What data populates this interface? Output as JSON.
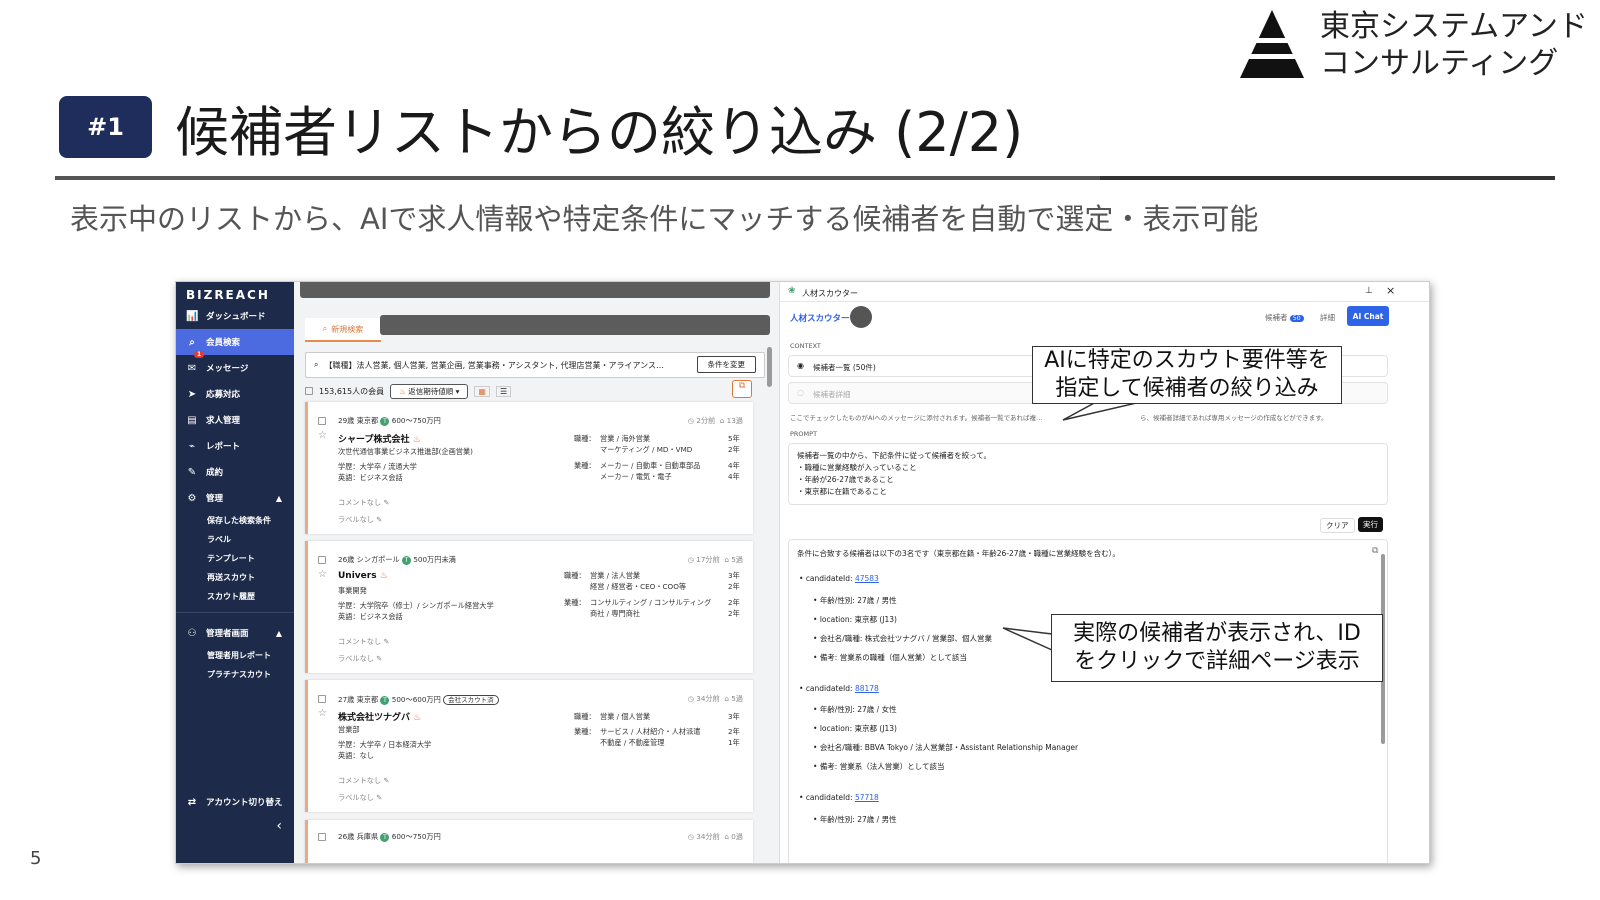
{
  "slide": {
    "badge": "#1",
    "title": "候補者リストからの絞り込み (2/2)",
    "subtitle": "表示中のリストから、AIで求人情報や特定条件にマッチする候補者を自動で選定・表示可能",
    "company_line1": "東京システムアンド",
    "company_line2": "コンサルティング",
    "page_number": "5"
  },
  "sidebar": {
    "brand": "BIZREACH",
    "items": [
      {
        "icon": "chart-icon",
        "glyph": "📊",
        "label": "ダッシュボード"
      },
      {
        "icon": "search-icon",
        "glyph": "🔍",
        "label": "会員検索"
      },
      {
        "icon": "mail-icon",
        "glyph": "✉",
        "label": "メッセージ",
        "badge": "1"
      },
      {
        "icon": "send-icon",
        "glyph": "➤",
        "label": "応募対応"
      },
      {
        "icon": "document-icon",
        "glyph": "▤",
        "label": "求人管理"
      },
      {
        "icon": "report-icon",
        "glyph": "📈",
        "label": "レポート"
      },
      {
        "icon": "edit-icon",
        "glyph": "✎",
        "label": "成約"
      },
      {
        "icon": "gear-icon",
        "glyph": "⚙",
        "label": "管理"
      }
    ],
    "admin_subs": [
      "保存した検索条件",
      "ラベル",
      "テンプレート",
      "再送スカウト",
      "スカウト履歴"
    ],
    "manager": {
      "icon": "users-icon",
      "label": "管理者画面"
    },
    "manager_subs": [
      "管理者用レポート",
      "プラチナスカウト"
    ],
    "switch_account": "アカウント切り替え",
    "collapse": "‹"
  },
  "main": {
    "tab": "新規検索",
    "search_text": "【職種】法人営業, 個人営業, 営業企画, 営業事務・アシスタント, 代理店営業・アライアンス…",
    "change_button": "条件を変更",
    "count": "153,615人の会員",
    "sort": "返信期待値順",
    "cards": [
      {
        "meta": "29歳 東京都",
        "salary": "600〜750万円",
        "time": "2分前",
        "count": "13過",
        "company": "シャープ株式会社",
        "dept": "次世代通信事業ビジネス推進部(企画営業)",
        "edu": "学歴：大学卒 / 流通大学",
        "lang": "英語：ビジネス会話",
        "job_label": "職種：",
        "jobs": [
          "営業 / 海外営業",
          "マーケティング / MD・VMD"
        ],
        "job_years": [
          "5年",
          "2年"
        ],
        "ind_label": "業種：",
        "inds": [
          "メーカー / 自動車・自動車部品",
          "メーカー / 電気・電子"
        ],
        "ind_years": [
          "4年",
          "4年"
        ],
        "comment": "コメントなし",
        "label": "ラベルなし"
      },
      {
        "meta": "26歳 シンガポール",
        "salary": "500万円未満",
        "time": "17分前",
        "count": "5過",
        "company": "Univers",
        "dept": "事業開発",
        "edu": "学歴：大学院卒（修士）/ シンガポール経営大学",
        "lang": "英語：ビジネス会話",
        "job_label": "職種：",
        "jobs": [
          "営業 / 法人営業",
          "経営 / 経営者・CEO・COO等"
        ],
        "job_years": [
          "3年",
          "2年"
        ],
        "ind_label": "業種：",
        "inds": [
          "コンサルティング / コンサルティング",
          "商社 / 専門商社"
        ],
        "ind_years": [
          "2年",
          "2年"
        ],
        "comment": "コメントなし",
        "label": "ラベルなし"
      },
      {
        "meta": "27歳 東京都",
        "salary": "500〜600万円",
        "tag": "会社スカウト済",
        "time": "34分前",
        "count": "5過",
        "company": "株式会社ツナグバ",
        "dept": "営業部",
        "edu": "学歴：大学卒 / 日本経済大学",
        "lang": "英語：なし",
        "job_label": "職種：",
        "jobs": [
          "営業 / 個人営業"
        ],
        "job_years": [
          "3年"
        ],
        "ind_label": "業種：",
        "inds": [
          "サービス / 人材紹介・人材派遣",
          "不動産 / 不動産管理"
        ],
        "ind_years": [
          "2年",
          "1年"
        ],
        "comment": "コメントなし",
        "label": "ラベルなし"
      }
    ],
    "peek": {
      "meta": "26歳 兵庫県",
      "salary": "600〜750万円",
      "time": "34分前",
      "count": "0過"
    }
  },
  "panel": {
    "window_title": "人材スカウター",
    "pin": "⊥",
    "close": "×",
    "name": "人材スカウター",
    "candidates_label": "候補者",
    "candidates_count": "50",
    "detail": "詳細",
    "ai_chat": "AI Chat",
    "context_label": "CONTEXT",
    "context_option1": "候補者一覧 (50件)",
    "context_option2": "候補者詳細",
    "context_note": "ここでチェックしたものがAIへのメッセージに添付されます。候補者一覧であれば複…",
    "context_note2": "ら、候補者詳細であれば専用メッセージの作成などができます。",
    "prompt_label": "PROMPT",
    "prompt_lines": [
      "候補者一覧の中から、下記条件に従って候補者を絞って。",
      "・職種に営業経験が入っていること",
      "・年齢が26-27歳であること",
      "・東京都に在籍であること"
    ],
    "clear": "クリア",
    "run": "実行",
    "result_intro": "条件に合致する候補者は以下の3名です（東京都在籍・年齢26-27歳・職種に営業経験を含む）。",
    "results": [
      {
        "id_label": "candidateId:",
        "id": "47583",
        "lines": [
          "年齢/性別: 27歳 / 男性",
          "location: 東京都 (J13)",
          "会社名/職種: 株式会社ツナグバ / 営業部、個人営業",
          "備考: 営業系の職種（個人営業）として該当"
        ]
      },
      {
        "id_label": "candidateId:",
        "id": "88178",
        "lines": [
          "年齢/性別: 27歳 / 女性",
          "location: 東京都 (J13)",
          "会社名/職種: BBVA Tokyo / 法人営業部・Assistant Relationship Manager",
          "備考: 営業系（法人営業）として該当"
        ]
      },
      {
        "id_label": "candidateId:",
        "id": "57718",
        "lines": [
          "年齢/性別: 27歳 / 男性"
        ]
      }
    ]
  },
  "callouts": {
    "top": [
      "AIに特定のスカウト要件等を",
      "指定して候補者の絞り込み"
    ],
    "bottom": [
      "実際の候補者が表示され、ID",
      "をクリックで詳細ページ表示"
    ]
  }
}
